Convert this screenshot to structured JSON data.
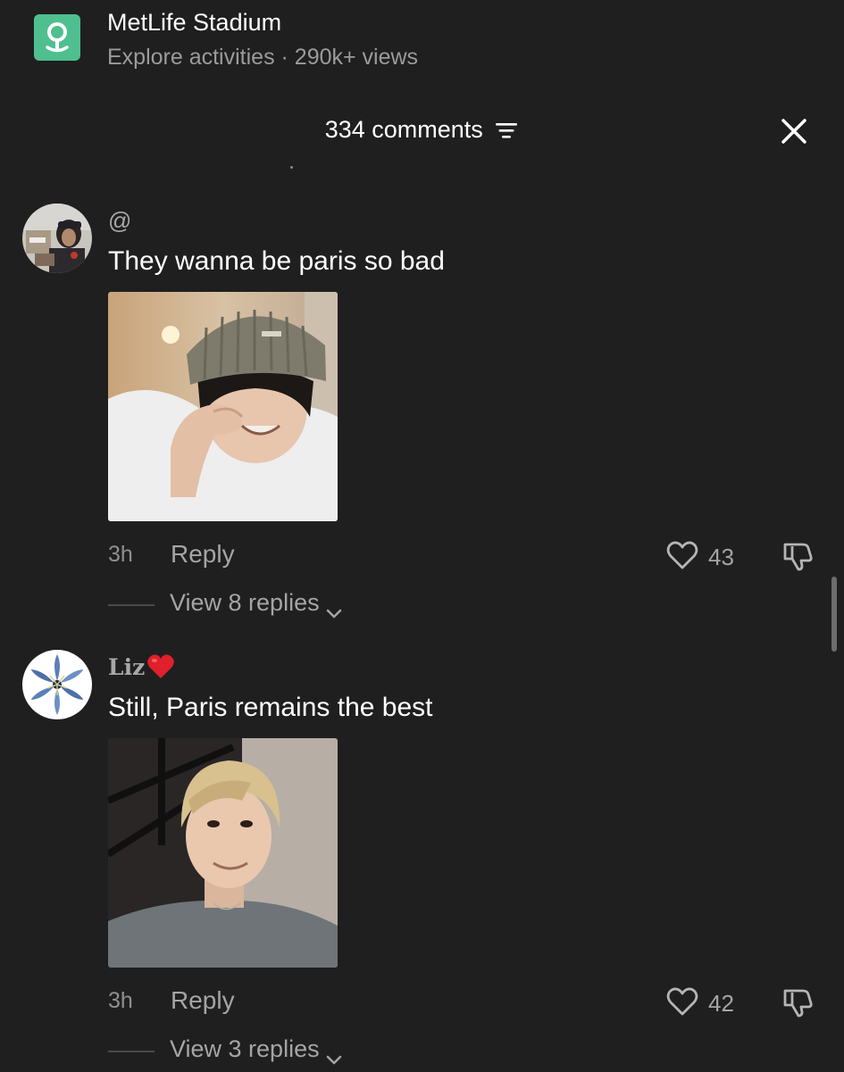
{
  "location": {
    "icon": "map-pin-icon",
    "title": "MetLife Stadium",
    "subtitle": "Explore activities · 290k+ views",
    "accent_color": "#4fbf8f"
  },
  "comments_header": {
    "count_label": "334 comments",
    "sort_icon": "sort-lines-icon",
    "close_icon": "close-icon"
  },
  "comments": [
    {
      "username": "@",
      "text": "They wanna be paris so bad",
      "time": "3h",
      "reply_label": "Reply",
      "likes": "43",
      "view_replies": "View 8 replies"
    },
    {
      "username": "Liz",
      "username_emoji": "red-heart-icon",
      "text": "Still, Paris remains the best",
      "time": "3h",
      "reply_label": "Reply",
      "likes": "42",
      "view_replies": "View 3 replies"
    }
  ],
  "colors": {
    "background": "#1f1f1f",
    "primary_text": "#ffffff",
    "secondary_text": "#a5a5a5"
  }
}
